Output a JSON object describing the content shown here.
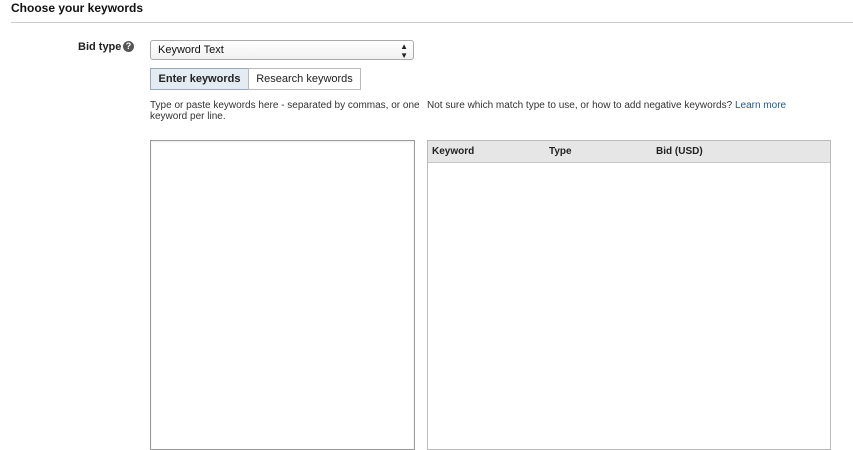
{
  "section": {
    "title": "Choose your keywords"
  },
  "bid_type": {
    "label": "Bid type",
    "help_icon": "?",
    "selected": "Keyword Text",
    "arrows": "▲▼"
  },
  "tabs": [
    {
      "label": "Enter keywords",
      "active": true
    },
    {
      "label": "Research keywords",
      "active": false
    }
  ],
  "instructions": "Type or paste keywords here - separated by commas, or one keyword per line.",
  "help": {
    "text": "Not sure which match type to use, or how to add negative keywords?",
    "link": "Learn more"
  },
  "keyword_input": {
    "value": ""
  },
  "table": {
    "columns": [
      "Keyword",
      "Type",
      "Bid (USD)"
    ],
    "rows": []
  },
  "colors": {
    "active_tab_bg": "#e3ebf3",
    "link": "#1a5a9a",
    "table_header_bg": "#e6e6e6"
  }
}
